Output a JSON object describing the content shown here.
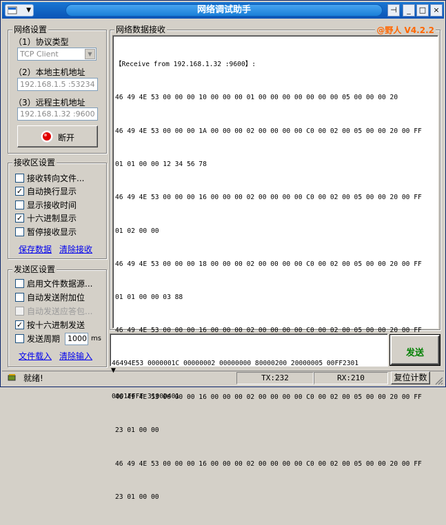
{
  "window": {
    "title": "网络调试助手",
    "sysmenu_icon": "application-icon",
    "pin_glyph": "⊣",
    "min_glyph": "_",
    "max_glyph": "□",
    "close_glyph": "×"
  },
  "net": {
    "group_title": "网络设置",
    "protocol_label": "（1）协议类型",
    "protocol_value": "TCP Client",
    "local_label": "（2）本地主机地址",
    "local_value": "192.168.1.5 :53234",
    "remote_label": "（3）远程主机地址",
    "remote_value": "192.168.1.32 :9600",
    "disconnect_label": "断开"
  },
  "recv_settings": {
    "group_title": "接收区设置",
    "options": [
      {
        "label": "接收转向文件...",
        "checked": false,
        "disabled": false
      },
      {
        "label": "自动换行显示",
        "checked": true,
        "disabled": false
      },
      {
        "label": "显示接收时间",
        "checked": false,
        "disabled": false
      },
      {
        "label": "十六进制显示",
        "checked": true,
        "disabled": false
      },
      {
        "label": "暂停接收显示",
        "checked": false,
        "disabled": false
      }
    ],
    "save_link": "保存数据",
    "clear_link": "清除接收"
  },
  "send_settings": {
    "group_title": "发送区设置",
    "options": [
      {
        "label": "启用文件数据源...",
        "checked": false,
        "disabled": false
      },
      {
        "label": "自动发送附加位",
        "checked": false,
        "disabled": false
      },
      {
        "label": "自动发送应答包...",
        "checked": false,
        "disabled": true
      },
      {
        "label": "按十六进制发送",
        "checked": true,
        "disabled": false
      },
      {
        "label": "发送周期",
        "checked": false,
        "disabled": false
      }
    ],
    "period_value": "1000",
    "period_unit": "ms",
    "load_link": "文件载入",
    "clear_link": "清除输入"
  },
  "receive_area": {
    "title": "网络数据接收",
    "version": "@野人 V4.2.2",
    "header_line": "【Receive from 192.168.1.32 :9600】:",
    "lines": [
      "46 49 4E 53 00 00 00 10 00 00 00 01 00 00 00 00 00 00 00 05 00 00 00 20",
      "46 49 4E 53 00 00 00 1A 00 00 00 02 00 00 00 00 C0 00 02 00 05 00 00 20 00 FF",
      "01 01 00 00 12 34 56 78",
      "46 49 4E 53 00 00 00 16 00 00 00 02 00 00 00 00 C0 00 02 00 05 00 00 20 00 FF",
      "01 02 00 00",
      "46 49 4E 53 00 00 00 18 00 00 00 02 00 00 00 00 C0 00 02 00 05 00 00 20 00 FF",
      "01 01 00 00 03 88",
      "46 49 4E 53 00 00 00 16 00 00 00 02 00 00 00 00 C0 00 02 00 05 00 00 20 00 FF",
      "23 01 00 00",
      "46 49 4E 53 00 00 00 16 00 00 00 02 00 00 00 00 C0 00 02 00 05 00 00 20 00 FF",
      "23 01 00 00",
      "46 49 4E 53 00 00 00 16 00 00 00 02 00 00 00 00 C0 00 02 00 05 00 00 20 00 FF",
      "23 01 00 00"
    ]
  },
  "send_area": {
    "line1": "46494E53 0000001C 00000002 00000000 80000200 20000005 00FF2301",
    "line2": "0001FFFF 3100D401",
    "send_button": "发送"
  },
  "status": {
    "ready": "就绪!",
    "tx": "TX:232",
    "rx": "RX:210",
    "reset_button": "复位计数"
  },
  "colors": {
    "version": "#ff6600",
    "send_button_text": "#008000",
    "link": "#0000ee"
  }
}
